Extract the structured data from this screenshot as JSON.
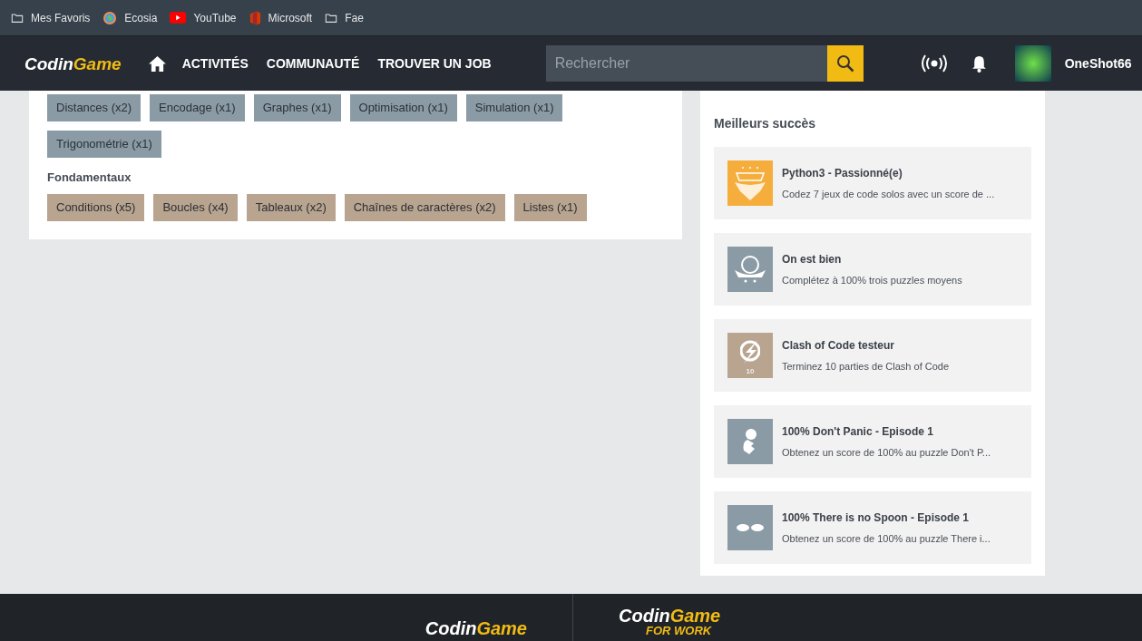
{
  "bookmarks": [
    {
      "kind": "folder",
      "label": "Mes Favoris"
    },
    {
      "kind": "globe",
      "label": "Ecosia"
    },
    {
      "kind": "play",
      "label": "YouTube"
    },
    {
      "kind": "office",
      "label": "Microsoft"
    },
    {
      "kind": "folder",
      "label": "Fae"
    }
  ],
  "nav": {
    "logo": {
      "first": "Codin",
      "second": "Game"
    },
    "links": [
      "ACTIVITÉS",
      "COMMUNAUTÉ",
      "TROUVER UN JOB"
    ],
    "search": {
      "placeholder": "Rechercher"
    },
    "username": "OneShot66"
  },
  "tag_groups": [
    {
      "color": "#8a9ba5",
      "tags": [
        "Distances (x2)",
        "Encodage (x1)",
        "Graphes (x1)",
        "Optimisation (x1)",
        "Simulation (x1)",
        "Trigonométrie (x1)"
      ]
    },
    {
      "title": "Fondamentaux",
      "color": "#b8a48f",
      "tags": [
        "Conditions (x5)",
        "Boucles (x4)",
        "Tableaux (x2)",
        "Chaînes de caractères (x2)",
        "Listes (x1)"
      ]
    }
  ],
  "achievements": {
    "title": "Meilleurs succès",
    "items": [
      {
        "kind": "trophy",
        "color": "#f5ae3c",
        "title": "Python3 - Passionné(e)",
        "description": "Codez 7 jeux de code solos avec un score de ..."
      },
      {
        "kind": "badge",
        "color": "#8a9ba5",
        "title": "On est bien",
        "description": "Complétez à 100% trois puzzles moyens"
      },
      {
        "kind": "clash",
        "color": "#b8a48f",
        "title": "Clash of Code testeur",
        "description": "Terminez 10 parties de Clash of Code",
        "badge_number": "10"
      },
      {
        "kind": "character",
        "color": "#8a9ba5",
        "title": "100% Don't Panic - Episode 1",
        "description": "Obtenez un score de 100% au puzzle Don't P..."
      },
      {
        "kind": "glasses",
        "color": "#8a9ba5",
        "title": "100% There is no Spoon - Episode 1",
        "description": "Obtenez un score de 100% au puzzle There i..."
      }
    ]
  },
  "footer": {
    "logo": {
      "first": "Codin",
      "second": "Game"
    },
    "work_logo": {
      "first": "Codin",
      "second": "Game",
      "sub": "FOR WORK"
    }
  }
}
